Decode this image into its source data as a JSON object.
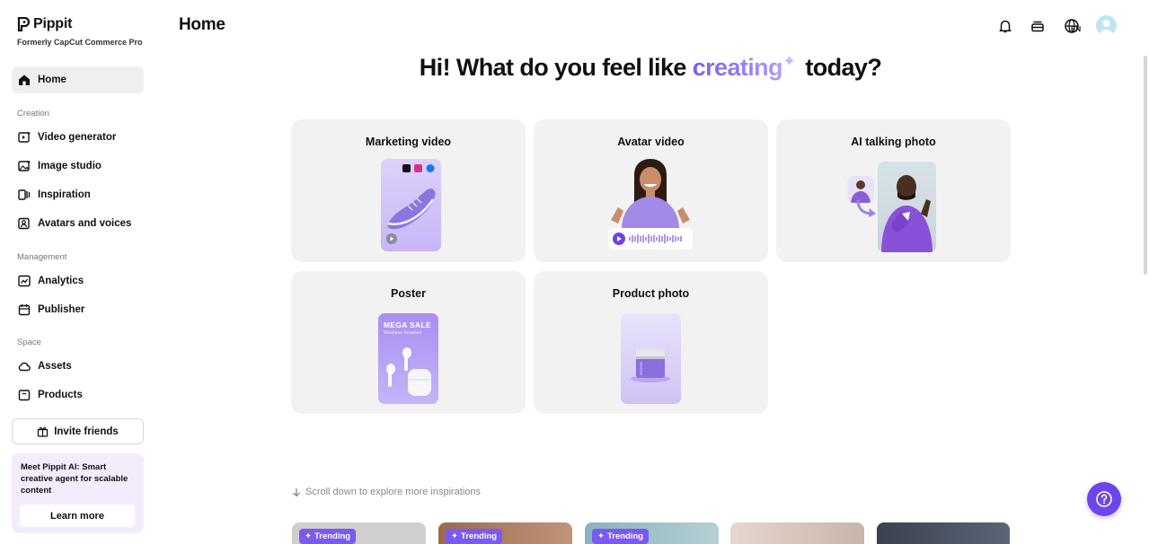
{
  "brand": {
    "name": "Pippit",
    "subtitle": "Formerly CapCut Commerce Pro"
  },
  "sidebar": {
    "home": {
      "label": "Home",
      "icon": "home-icon"
    },
    "sections": [
      {
        "label": "Creation",
        "items": [
          {
            "label": "Video generator",
            "icon": "video-generator-icon"
          },
          {
            "label": "Image studio",
            "icon": "image-studio-icon"
          },
          {
            "label": "Inspiration",
            "icon": "inspiration-icon"
          },
          {
            "label": "Avatars and voices",
            "icon": "avatar-voice-icon"
          }
        ]
      },
      {
        "label": "Management",
        "items": [
          {
            "label": "Analytics",
            "icon": "analytics-icon"
          },
          {
            "label": "Publisher",
            "icon": "calendar-icon"
          }
        ]
      },
      {
        "label": "Space",
        "items": [
          {
            "label": "Assets",
            "icon": "cloud-icon"
          },
          {
            "label": "Products",
            "icon": "box-icon"
          }
        ]
      }
    ],
    "invite": "Invite friends",
    "promo": {
      "text": "Meet Pippit AI: Smart creative agent for scalable content",
      "button": "Learn more"
    }
  },
  "header": {
    "title": "Home",
    "lang": "EN"
  },
  "hero": {
    "prefix": "Hi! What do you feel like ",
    "accent": "creating",
    "suffix": " today?"
  },
  "cards": [
    {
      "title": "Marketing video"
    },
    {
      "title": "Avatar video"
    },
    {
      "title": "AI talking photo"
    },
    {
      "title": "Poster",
      "poster_title": "MEGA SALE",
      "poster_sub": "Wireless headset"
    },
    {
      "title": "Product photo"
    }
  ],
  "scroll_hint": "Scroll down to explore more inspirations",
  "trending_label": "Trending",
  "colors": {
    "accent": "#7a5af0",
    "help": "#6b46ea",
    "promo_bg": "#f3ecfd"
  }
}
